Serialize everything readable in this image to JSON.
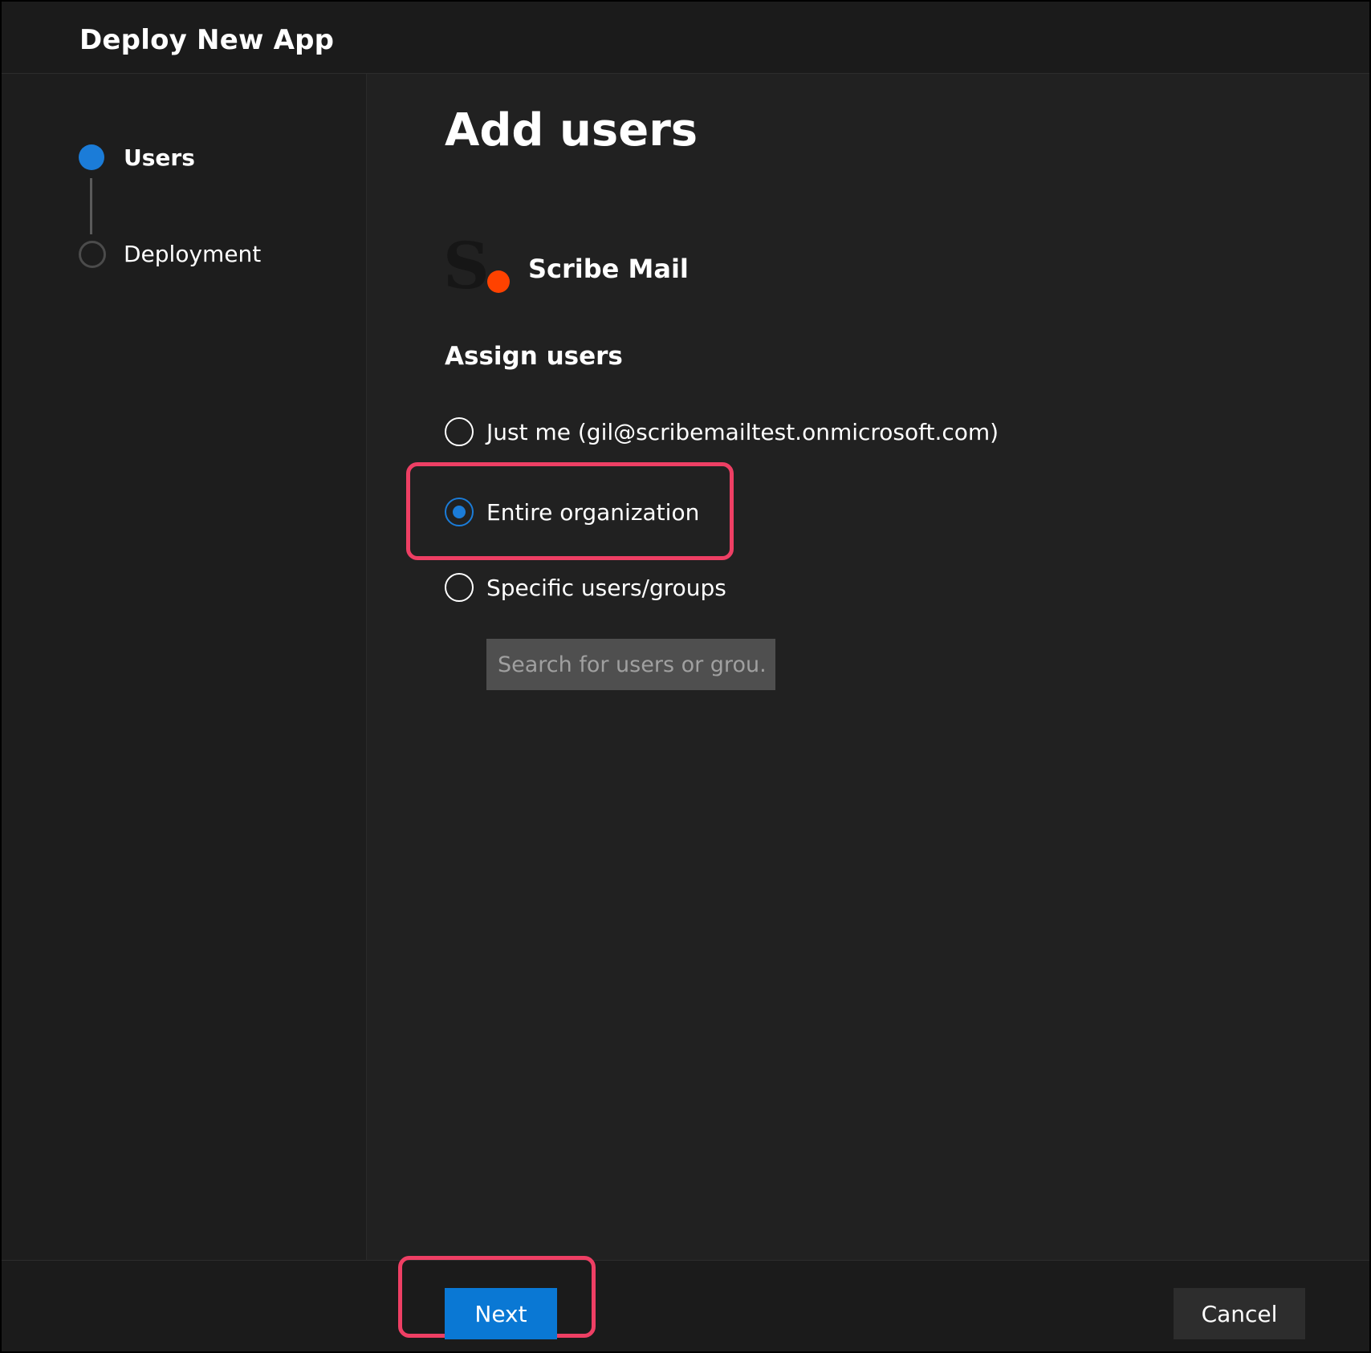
{
  "dialog": {
    "title": "Deploy New App"
  },
  "steps": [
    {
      "label": "Users",
      "state": "active"
    },
    {
      "label": "Deployment",
      "state": "pending"
    }
  ],
  "main": {
    "title": "Add users",
    "app": {
      "logo_letter": "S",
      "name": "Scribe Mail"
    },
    "assign_heading": "Assign users",
    "options": [
      {
        "label": "Just me (gil@scribemailtest.onmicrosoft.com)",
        "checked": false
      },
      {
        "label": "Entire organization",
        "checked": true
      },
      {
        "label": "Specific users/groups",
        "checked": false
      }
    ],
    "search": {
      "placeholder": "Search for users or grou...",
      "value": ""
    }
  },
  "footer": {
    "next_label": "Next",
    "cancel_label": "Cancel"
  },
  "colors": {
    "accent": "#0a78d4",
    "highlight": "#ee3f64",
    "logo_dot": "#ff4200"
  }
}
